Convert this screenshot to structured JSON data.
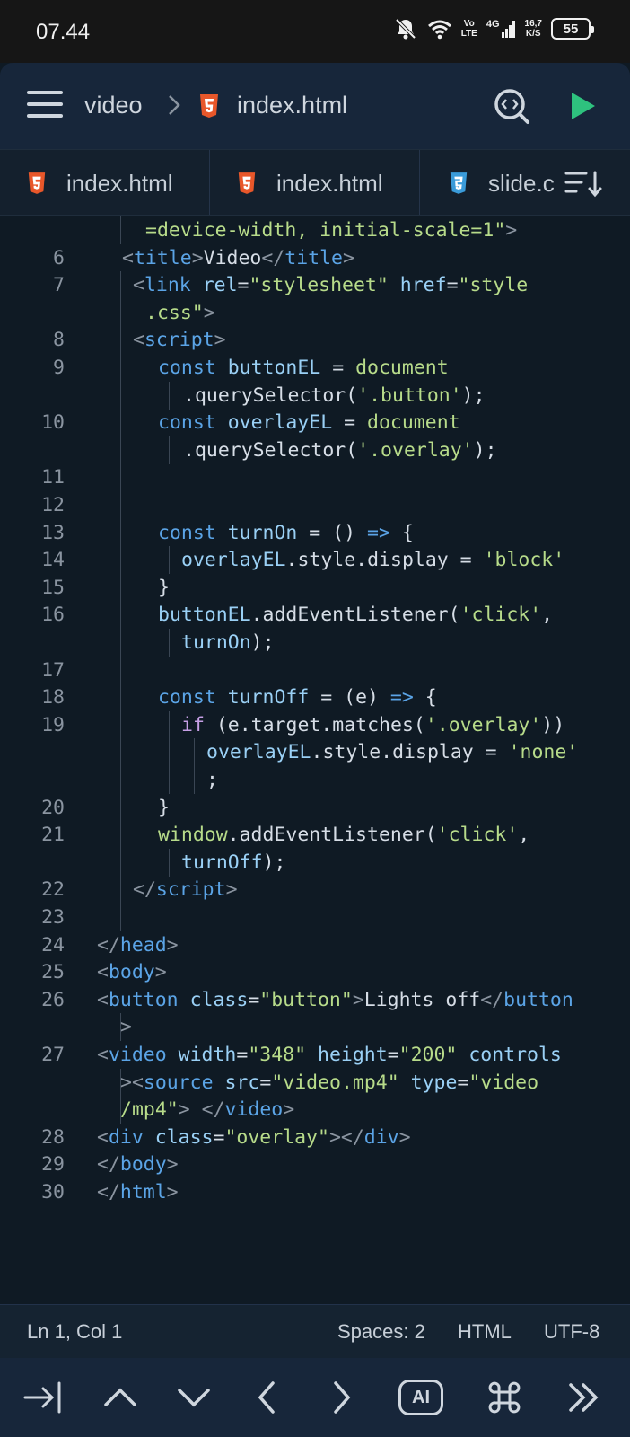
{
  "status_bar": {
    "time": "07.44",
    "net_label_top": "Vo",
    "net_label_bottom": "LTE",
    "signal_label": "4G",
    "speed_top": "16,7",
    "speed_bottom": "K/S",
    "battery": "55"
  },
  "header": {
    "folder": "video",
    "file": "index.html"
  },
  "tabs": [
    {
      "label": "index.html",
      "type": "html"
    },
    {
      "label": "index.html",
      "type": "html"
    },
    {
      "label": "slide.c",
      "type": "css"
    }
  ],
  "code_lines": [
    {
      "num": "",
      "html": "<span class=\"s\">=device-width, initial-scale=1\"</span><span class=\"p\">></span>"
    },
    {
      "num": "6",
      "html": "<span class=\"p\">&lt;</span><span class=\"t\">title</span><span class=\"p\">></span>Video<span class=\"p\">&lt;/</span><span class=\"t\">title</span><span class=\"p\">></span>"
    },
    {
      "num": "7",
      "html": "<span class=\"p\">&lt;</span><span class=\"t\">link</span> <span class=\"a\">rel</span>=<span class=\"s\">\"stylesheet\"</span> <span class=\"a\">href</span>=<span class=\"s\">\"style</span>"
    },
    {
      "num": "",
      "html": "<span class=\"s\">.css\"</span><span class=\"p\">></span>"
    },
    {
      "num": "8",
      "html": "<span class=\"p\">&lt;</span><span class=\"t\">script</span><span class=\"p\">></span>"
    },
    {
      "num": "9",
      "html": "<span class=\"k\">const</span> <span class=\"v\">buttonEL</span> = <span class=\"f\">document</span>"
    },
    {
      "num": "",
      "html": ".querySelector(<span class=\"s\">'.button'</span>);"
    },
    {
      "num": "10",
      "html": "<span class=\"k\">const</span> <span class=\"v\">overlayEL</span> = <span class=\"f\">document</span>"
    },
    {
      "num": "",
      "html": ".querySelector(<span class=\"s\">'.overlay'</span>);"
    },
    {
      "num": "11",
      "html": ""
    },
    {
      "num": "12",
      "html": ""
    },
    {
      "num": "13",
      "html": "<span class=\"k\">const</span> <span class=\"v\">turnOn</span> = () <span class=\"k\">=></span> {"
    },
    {
      "num": "14",
      "html": "<span class=\"v\">overlayEL</span>.style.display = <span class=\"s\">'block'</span>"
    },
    {
      "num": "15",
      "html": "}"
    },
    {
      "num": "16",
      "html": "<span class=\"v\">buttonEL</span>.addEventListener(<span class=\"s\">'click'</span>,"
    },
    {
      "num": "",
      "html": "<span class=\"v\">turnOn</span>);"
    },
    {
      "num": "17",
      "html": ""
    },
    {
      "num": "18",
      "html": "<span class=\"k\">const</span> <span class=\"v\">turnOff</span> = (e) <span class=\"k\">=></span> {"
    },
    {
      "num": "19",
      "html": "<span class=\"m\">if</span> (e.target.matches(<span class=\"s\">'.overlay'</span>))"
    },
    {
      "num": "",
      "html": "<span class=\"v\">overlayEL</span>.style.display = <span class=\"s\">'none'</span>"
    },
    {
      "num": "",
      "html": ";"
    },
    {
      "num": "20",
      "html": "}"
    },
    {
      "num": "21",
      "html": "<span class=\"f\">window</span>.addEventListener(<span class=\"s\">'click'</span>,"
    },
    {
      "num": "",
      "html": "<span class=\"v\">turnOff</span>);"
    },
    {
      "num": "22",
      "html": "<span class=\"p\">&lt;/</span><span class=\"t\">script</span><span class=\"p\">></span>"
    },
    {
      "num": "23",
      "html": ""
    },
    {
      "num": "24",
      "html": "<span class=\"p\">&lt;/</span><span class=\"t\">head</span><span class=\"p\">></span>"
    },
    {
      "num": "25",
      "html": "<span class=\"p\">&lt;</span><span class=\"t\">body</span><span class=\"p\">></span>"
    },
    {
      "num": "26",
      "html": "<span class=\"p\">&lt;</span><span class=\"t\">button</span> <span class=\"a\">class</span>=<span class=\"s\">\"button\"</span><span class=\"p\">></span>Lights off<span class=\"p\">&lt;/</span><span class=\"t\">button</span>"
    },
    {
      "num": "",
      "html": "<span class=\"p\">></span>"
    },
    {
      "num": "27",
      "html": "<span class=\"p\">&lt;</span><span class=\"t\">video</span> <span class=\"a\">width</span>=<span class=\"s\">\"348\"</span> <span class=\"a\">height</span>=<span class=\"s\">\"200\"</span> <span class=\"a\">controls</span>"
    },
    {
      "num": "",
      "html": "<span class=\"p\">>&lt;</span><span class=\"t\">source</span> <span class=\"a\">src</span>=<span class=\"s\">\"video.mp4\"</span> <span class=\"a\">type</span>=<span class=\"s\">\"video</span>"
    },
    {
      "num": "",
      "html": "<span class=\"s\">/mp4\"</span><span class=\"p\">></span> <span class=\"p\">&lt;/</span><span class=\"t\">video</span><span class=\"p\">></span>"
    },
    {
      "num": "28",
      "html": "<span class=\"p\">&lt;</span><span class=\"t\">div</span> <span class=\"a\">class</span>=<span class=\"s\">\"overlay\"</span><span class=\"p\">>&lt;/</span><span class=\"t\">div</span><span class=\"p\">></span>"
    },
    {
      "num": "29",
      "html": "<span class=\"p\">&lt;/</span><span class=\"t\">body</span><span class=\"p\">></span>"
    },
    {
      "num": "30",
      "html": "<span class=\"p\">&lt;/</span><span class=\"t\">html</span><span class=\"p\">></span>"
    }
  ],
  "statusline": {
    "position": "Ln 1, Col 1",
    "indent": "Spaces: 2",
    "language": "HTML",
    "encoding": "UTF-8"
  },
  "toolbar": {
    "tab_key": "tab-icon",
    "up": "arrow-up-icon",
    "down": "arrow-down-icon",
    "left": "arrow-left-icon",
    "right": "arrow-right-icon",
    "ai_label": "AI",
    "command": "command-icon",
    "more": "double-chevron-icon"
  },
  "colors": {
    "accent_green": "#2ec27e",
    "html_orange": "#e8572a",
    "css_blue": "#3a9bd9"
  }
}
